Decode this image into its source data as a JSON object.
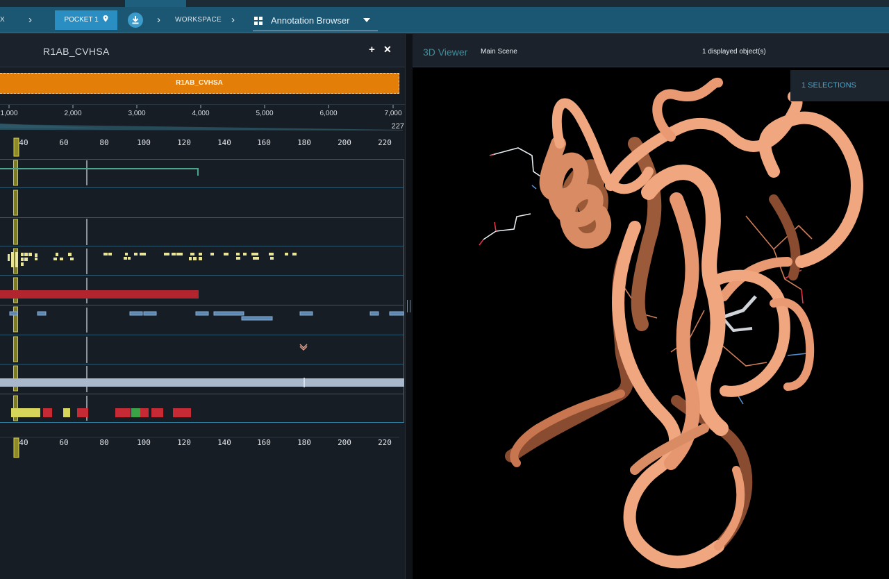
{
  "topbar": {
    "crumb_cut": "X",
    "pocket_label": "POCKET 1",
    "workspace_label": "WORKSPACE",
    "view_select": "Annotation Browser"
  },
  "left_panel": {
    "title": "R1AB_CVHSA",
    "protein_bar": "R1AB_CVHSA",
    "overview_ticks": [
      "1,000",
      "2,000",
      "3,000",
      "4,000",
      "5,000",
      "6,000",
      "7,000"
    ],
    "overview_end": "227",
    "zoom_ticks": [
      "40",
      "60",
      "80",
      "100",
      "120",
      "140",
      "160",
      "180",
      "200",
      "220"
    ],
    "bottom_ticks": [
      "40",
      "60",
      "80",
      "100",
      "120",
      "140",
      "160",
      "180",
      "200",
      "220"
    ]
  },
  "viewer": {
    "title": "3D Viewer",
    "scene": "Main Scene",
    "displayed": "1 displayed object(s)",
    "selections": "1 SELECTIONS"
  },
  "colors": {
    "topbar": "#1b5673",
    "accent": "#2a8ec2",
    "protein": "#e37e08",
    "ribbon": "#f0a77f",
    "highlight": "#c3bd3c",
    "variant": "#c62a35"
  }
}
